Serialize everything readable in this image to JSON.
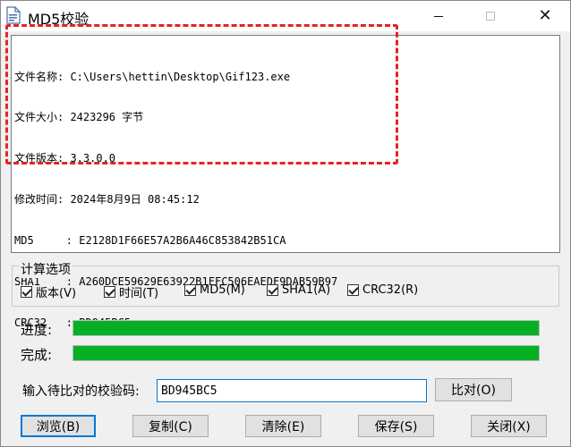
{
  "window": {
    "title": "MD5校验"
  },
  "output": {
    "lines": [
      "文件名称: C:\\Users\\hettin\\Desktop\\Gif123.exe",
      "文件大小: 2423296 字节",
      "文件版本: 3.3.0.0",
      "修改时间: 2024年8月9日 08:45:12",
      "MD5     : E2128D1F66E57A2B6A46C853842B51CA",
      "SHA1    : A260DCE59629E63922B1FFC506EAEDF9DAB59B97",
      "CRC32   : BD945BC5"
    ]
  },
  "options": {
    "title": "计算选项",
    "items": [
      {
        "label": "版本(V)",
        "checked": true
      },
      {
        "label": "时间(T)",
        "checked": true
      },
      {
        "label": "MD5(M)",
        "checked": true
      },
      {
        "label": "SHA1(A)",
        "checked": true
      },
      {
        "label": "CRC32(R)",
        "checked": true
      }
    ]
  },
  "progress": {
    "progress_label": "进度:",
    "progress_value": 100,
    "complete_label": "完成:",
    "complete_value": 100
  },
  "compare": {
    "label": "输入待比对的校验码:",
    "value": "BD945BC5",
    "button": "比对(O)"
  },
  "buttons": {
    "browse": "浏览(B)",
    "copy": "复制(C)",
    "clear": "清除(E)",
    "save": "保存(S)",
    "close": "关闭(X)"
  },
  "colors": {
    "accent": "#0078d7",
    "progress": "#06b025",
    "highlight": "#e5222a"
  }
}
